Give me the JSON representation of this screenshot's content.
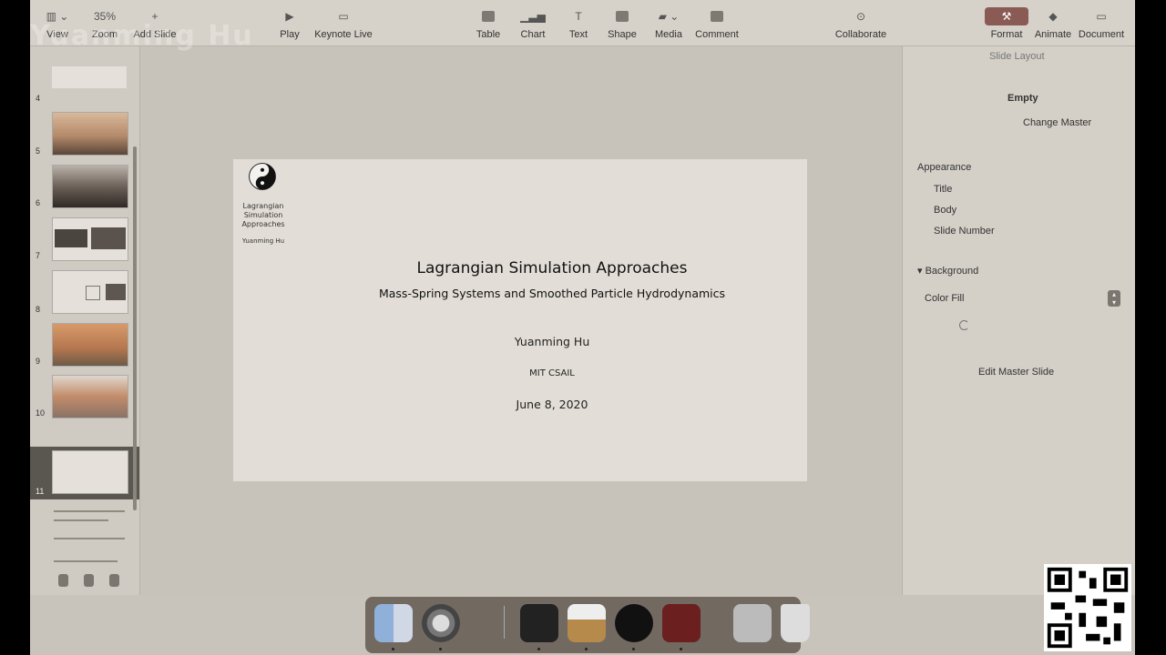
{
  "toolbar": {
    "view": "View",
    "zoom_value": "35%",
    "zoom": "Zoom",
    "add_slide": "Add Slide",
    "play": "Play",
    "keynote_live": "Keynote Live",
    "table": "Table",
    "chart": "Chart",
    "text": "Text",
    "shape": "Shape",
    "media": "Media",
    "comment": "Comment",
    "collaborate": "Collaborate",
    "format": "Format",
    "animate": "Animate",
    "document": "Document"
  },
  "navigator": {
    "slide_numbers": [
      "4",
      "5",
      "6",
      "7",
      "8",
      "9",
      "10",
      "11"
    ],
    "selected": "11"
  },
  "slide": {
    "side_title": "Lagrangian\nSimulation\nApproaches",
    "side_author": "Yuanming Hu",
    "title": "Lagrangian Simulation Approaches",
    "subtitle": "Mass-Spring Systems and Smoothed Particle Hydrodynamics",
    "author": "Yuanming Hu",
    "institute": "MIT CSAIL",
    "date": "June 8, 2020"
  },
  "inspector": {
    "heading": "Slide Layout",
    "layout_name": "Empty",
    "change_master": "Change Master",
    "appearance": "Appearance",
    "title_opt": "Title",
    "body_opt": "Body",
    "slide_number_opt": "Slide Number",
    "background": "Background",
    "color_fill": "Color Fill",
    "edit_master": "Edit Master Slide"
  },
  "colors": {
    "accent_active": "#8a5a55",
    "slide_bg": "#e2ded7",
    "screen_bg": "#c9c4bb"
  }
}
